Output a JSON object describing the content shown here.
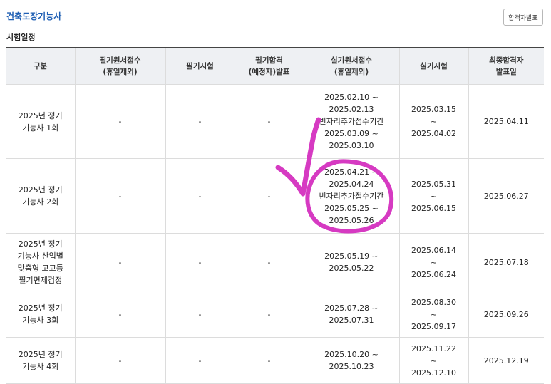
{
  "header": {
    "title": "건축도장기능사",
    "result_button": "합격자발표"
  },
  "section_title": "시험일정",
  "table": {
    "headers": [
      [
        "구분"
      ],
      [
        "필기원서접수",
        "(휴일제외)"
      ],
      [
        "필기시험"
      ],
      [
        "필기합격",
        "(예정자)발표"
      ],
      [
        "실기원서접수",
        "(휴일제외)"
      ],
      [
        "실기시험"
      ],
      [
        "최종합격자",
        "발표일"
      ]
    ],
    "rows": [
      {
        "cells": [
          [
            "2025년 정기",
            "기능사 1회"
          ],
          [
            "-"
          ],
          [
            "-"
          ],
          [
            "-"
          ],
          [
            "2025.02.10 ~",
            "2025.02.13",
            "빈자리추가접수기간",
            "2025.03.09 ~",
            "2025.03.10"
          ],
          [
            "2025.03.15",
            "~",
            "2025.04.02"
          ],
          [
            "2025.04.11"
          ]
        ]
      },
      {
        "cells": [
          [
            "2025년 정기",
            "기능사 2회"
          ],
          [
            "-"
          ],
          [
            "-"
          ],
          [
            "-"
          ],
          [
            "2025.04.21 ~",
            "2025.04.24",
            "빈자리추가접수기간",
            "2025.05.25 ~",
            "2025.05.26"
          ],
          [
            "2025.05.31",
            "~",
            "2025.06.15"
          ],
          [
            "2025.06.27"
          ]
        ]
      },
      {
        "cells": [
          [
            "2025년 정기",
            "기능사 산업별",
            "맞춤형 고교등",
            "필기면제검정"
          ],
          [
            "-"
          ],
          [
            "-"
          ],
          [
            "-"
          ],
          [
            "2025.05.19 ~",
            "2025.05.22"
          ],
          [
            "2025.06.14",
            "~",
            "2025.06.24"
          ],
          [
            "2025.07.18"
          ]
        ]
      },
      {
        "cells": [
          [
            "2025년 정기",
            "기능사 3회"
          ],
          [
            "-"
          ],
          [
            "-"
          ],
          [
            "-"
          ],
          [
            "2025.07.28 ~",
            "2025.07.31"
          ],
          [
            "2025.08.30",
            "~",
            "2025.09.17"
          ],
          [
            "2025.09.26"
          ]
        ]
      },
      {
        "cells": [
          [
            "2025년 정기",
            "기능사 4회"
          ],
          [
            "-"
          ],
          [
            "-"
          ],
          [
            "-"
          ],
          [
            "2025.10.20 ~",
            "2025.10.23"
          ],
          [
            "2025.11.22",
            "~",
            "2025.12.10"
          ],
          [
            "2025.12.19"
          ]
        ]
      }
    ]
  },
  "annotation": {
    "color": "#d63ac2"
  }
}
